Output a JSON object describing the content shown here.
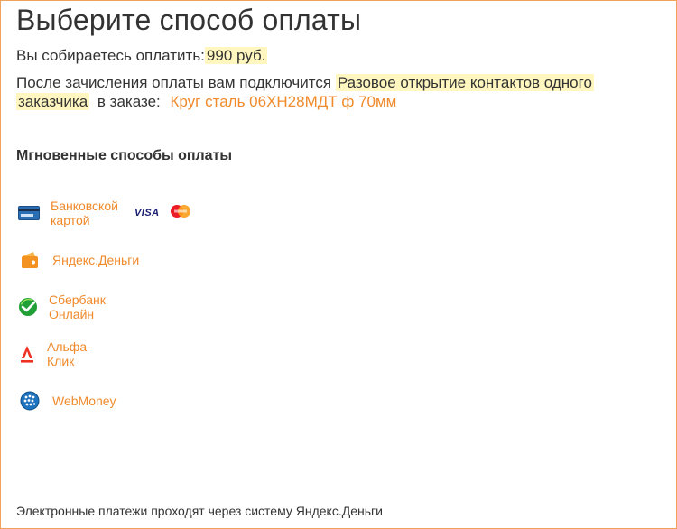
{
  "page": {
    "title": "Выберите способ оплаты",
    "amount_prefix": "Вы собираетесь оплатить:",
    "amount": "990 руб.",
    "connect_prefix": "После зачисления оплаты вам подключится",
    "service_part1": "Разовое открытие контактов одного",
    "service_part2": "заказчика",
    "order_prefix": "в заказе:",
    "order_name": "Круг сталь 06ХН28МДТ ф 70мм"
  },
  "section": {
    "title": "Мгновенные способы оплаты"
  },
  "methods": [
    {
      "label": "Банковской картой",
      "icon": "bank-card-icon",
      "brands": [
        "VISA",
        "MasterCard"
      ]
    },
    {
      "label": "Яндекс.Деньги",
      "icon": "yandex-money-icon"
    },
    {
      "label": "Сбербанк Онлайн",
      "icon": "sberbank-icon"
    },
    {
      "label": "Альфа-Клик",
      "icon": "alfa-bank-icon"
    },
    {
      "label": "WebMoney",
      "icon": "webmoney-icon"
    }
  ],
  "brands": {
    "visa": "VISA"
  },
  "footer": {
    "text": "Электронные платежи проходят через систему Яндекс.Деньги"
  },
  "colors": {
    "accent": "#f08a2b",
    "highlight": "#fff7bf",
    "border": "#f0a25a",
    "text": "#333333"
  }
}
